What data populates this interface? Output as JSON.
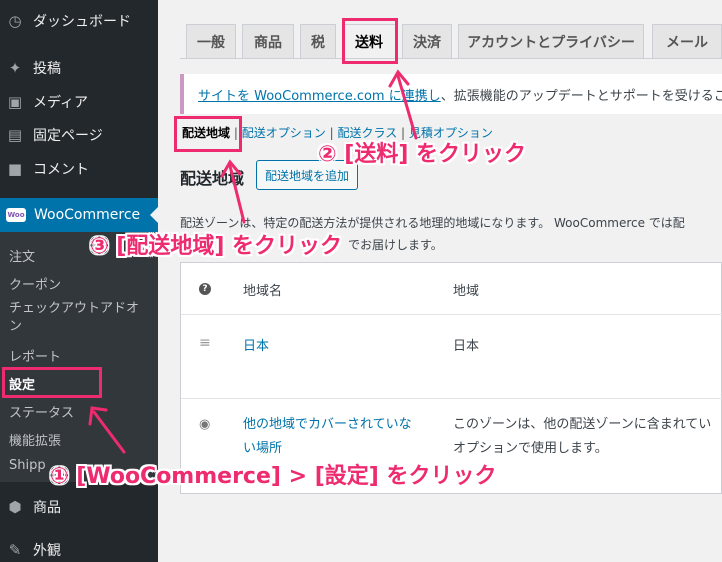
{
  "sidebar": {
    "items": [
      {
        "label": "ダッシュボード",
        "icon": "dashboard-icon"
      },
      {
        "label": "投稿",
        "icon": "pin-icon"
      },
      {
        "label": "メディア",
        "icon": "media-icon"
      },
      {
        "label": "固定ページ",
        "icon": "page-icon"
      },
      {
        "label": "コメント",
        "icon": "comment-icon"
      },
      {
        "label": "WooCommerce",
        "icon": "woocommerce-icon"
      },
      {
        "label": "商品",
        "icon": "product-icon"
      },
      {
        "label": "外観",
        "icon": "appearance-icon"
      }
    ],
    "woo_badge": "Woo",
    "submenu": [
      "注文",
      "クーポン",
      "チェックアウトアドオン",
      "レポート",
      "設定",
      "ステータス",
      "機能拡張",
      "Shipp"
    ]
  },
  "tabs": [
    "一般",
    "商品",
    "税",
    "送料",
    "決済",
    "アカウントとプライバシー",
    "メール"
  ],
  "notice": {
    "link": "サイトを WooCommerce.com に連携し",
    "rest": "、拡張機能のアップデートとサポートを受けること"
  },
  "subsub": {
    "current": "配送地域",
    "options": "配送オプション",
    "classes": "配送クラス",
    "estimate": "見積オプション",
    "sep": "|"
  },
  "zones": {
    "heading": "配送地域",
    "add_button": "配送地域を追加",
    "desc1": "配送ゾーンは、特定の配送方法が提供される地理的地域になります。 WooCommerce では配",
    "desc2": "でお届けします。",
    "col_name": "地域名",
    "col_region": "地域",
    "help": "?",
    "rows": [
      {
        "name": "日本",
        "region": "日本"
      },
      {
        "name_line1": "他の地域でカバーされていな",
        "name_line2": "い場所",
        "region_line1": "このゾーンは、他の配送ゾーンに含まれてい",
        "region_line2": "オプションで使用します。"
      }
    ]
  },
  "annotations": {
    "step1": "① [WooCommerce] > [設定] をクリック",
    "step2": "② [送料] をクリック",
    "step3": "③ [配送地域] をクリック"
  },
  "colors": {
    "accent": "#ee2b6f",
    "wp_blue": "#0073aa",
    "sidebar": "#23282d"
  }
}
